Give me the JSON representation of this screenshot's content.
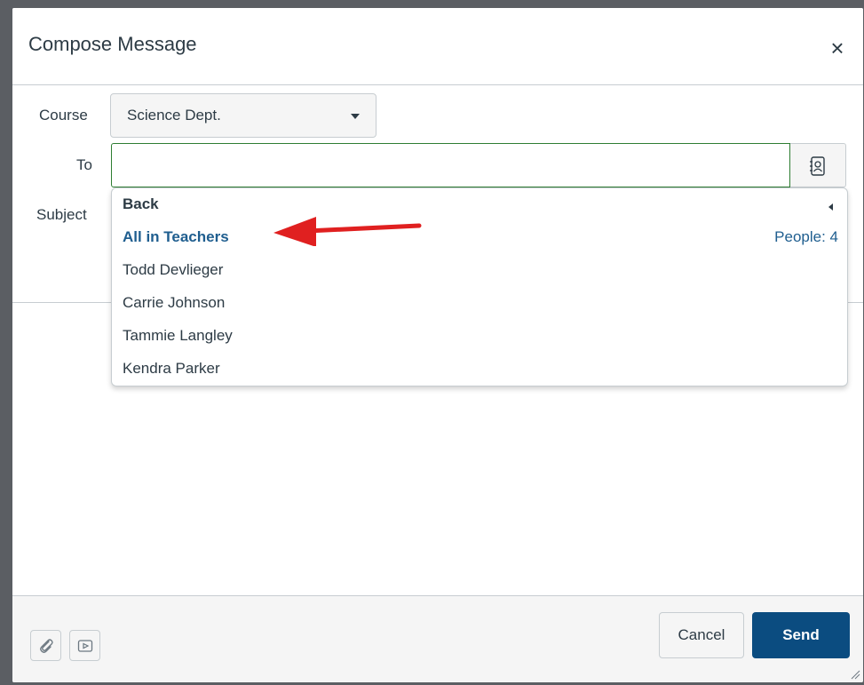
{
  "dialog": {
    "title": "Compose Message"
  },
  "form": {
    "course_label": "Course",
    "course_value": "Science Dept.",
    "to_label": "To",
    "to_value": "",
    "subject_label": "Subject"
  },
  "dropdown": {
    "back_label": "Back",
    "items": [
      {
        "label": "All in Teachers",
        "meta": "People: 4",
        "highlighted": true
      },
      {
        "label": "Todd Devlieger"
      },
      {
        "label": "Carrie Johnson"
      },
      {
        "label": "Tammie Langley"
      },
      {
        "label": "Kendra Parker"
      }
    ]
  },
  "footer": {
    "cancel_label": "Cancel",
    "send_label": "Send"
  },
  "icons": {
    "close": "close-icon",
    "course_caret": "caret-down-icon",
    "address_book": "address-book-icon",
    "attach": "paperclip-icon",
    "media": "media-icon",
    "resize": "resize-grip-icon"
  },
  "colors": {
    "accent": "#0b4c80",
    "link": "#1f5e8f",
    "annotation_arrow": "#e02020"
  }
}
